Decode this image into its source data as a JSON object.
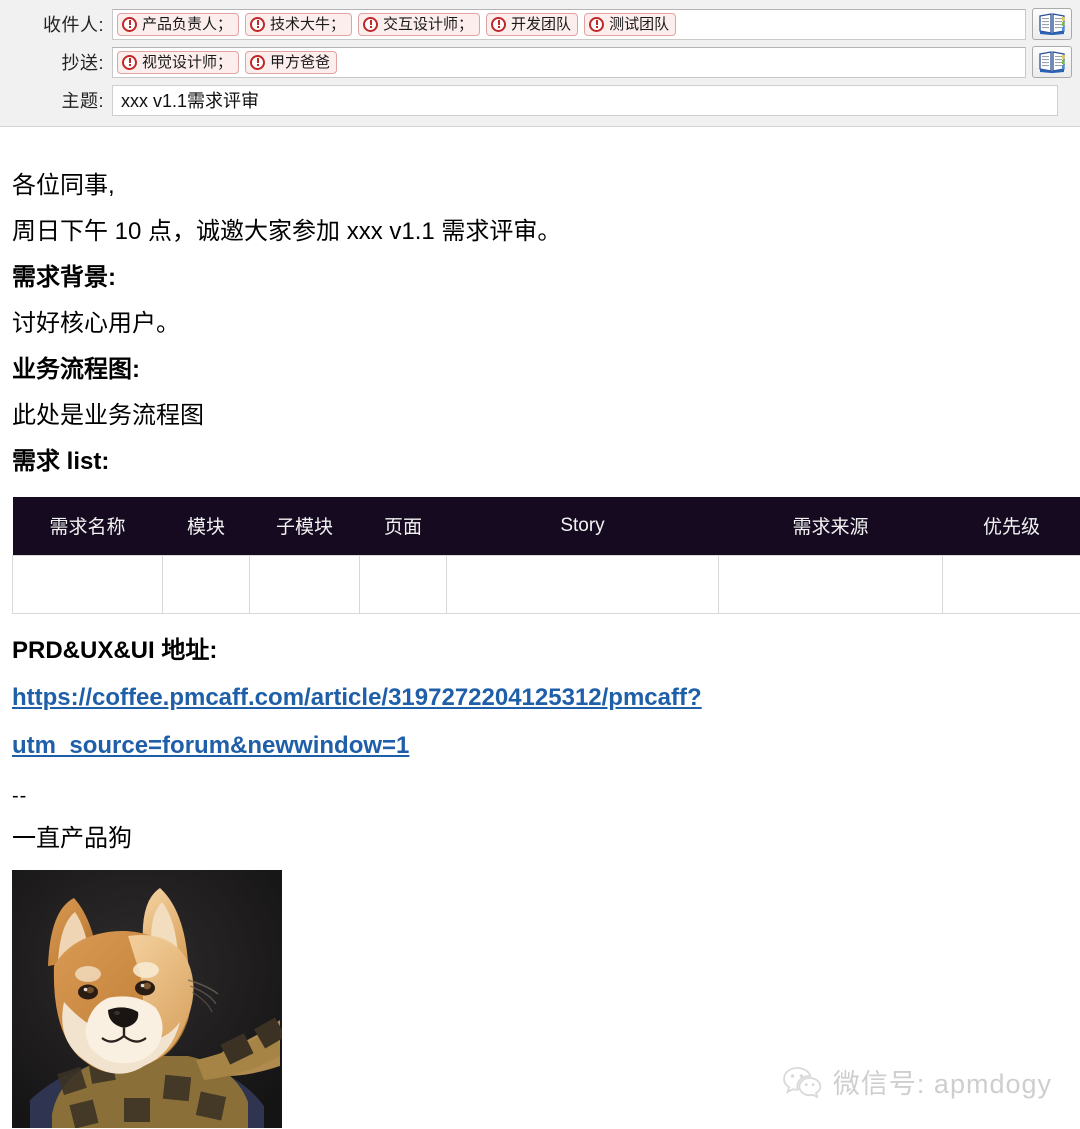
{
  "compose": {
    "to": {
      "label": "收件人:",
      "chips": [
        {
          "text": "产品负责人；",
          "icon": "error-circle-icon"
        },
        {
          "text": "技术大牛；",
          "icon": "error-circle-icon"
        },
        {
          "text": "交互设计师；",
          "icon": "error-circle-icon"
        },
        {
          "text": "开发团队",
          "icon": "error-circle-icon"
        },
        {
          "text": "测试团队",
          "icon": "error-circle-icon"
        }
      ],
      "addressbook_icon": "address-book-icon"
    },
    "cc": {
      "label": "抄送:",
      "chips": [
        {
          "text": "视觉设计师；",
          "icon": "error-circle-icon"
        },
        {
          "text": "甲方爸爸",
          "icon": "error-circle-icon"
        }
      ],
      "addressbook_icon": "address-book-icon"
    },
    "subject": {
      "label": "主题:",
      "value": "xxx v1.1需求评审",
      "placeholder": ""
    }
  },
  "body": {
    "greeting": "各位同事,",
    "intro": "周日下午 10 点，诚邀大家参加 xxx v1.1 需求评审。",
    "heading_background": "需求背景:",
    "background_text": "讨好核心用户。",
    "heading_flowchart": "业务流程图:",
    "flowchart_text": "此处是业务流程图",
    "heading_req_list": "需求 list:",
    "heading_prd": "PRD&UX&UI 地址:",
    "link_line_1": "https://coffee.pmcaff.com/article/3197272204125312/pmcaff?",
    "link_line_2": "utm_source=forum&newwindow=1",
    "signature_divider": "--",
    "signature_name": "一直产品狗",
    "photo_alt": "shiba-inu-portrait"
  },
  "table": {
    "columns": [
      "需求名称",
      "模块",
      "子模块",
      "页面",
      "Story",
      "需求来源",
      "优先级"
    ],
    "rows": [
      [
        "",
        "",
        "",
        "",
        "",
        "",
        ""
      ]
    ]
  },
  "watermark": {
    "icon": "wechat-icon",
    "text": "微信号: apmdogy"
  },
  "colors": {
    "header_bg": "#f1f1f1",
    "table_header_bg": "#150a20",
    "link": "#1f5fa9",
    "chip_border": "#e2a3a3",
    "chip_bg": "#fdeeee",
    "chip_icon": "#c02828"
  }
}
